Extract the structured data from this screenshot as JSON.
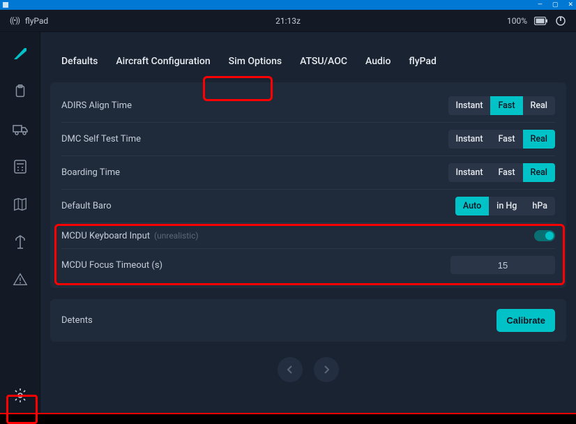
{
  "titlebar": {
    "minimize": "—",
    "maximize": "▢",
    "close": "✕"
  },
  "header": {
    "app_name": "flyPad",
    "time": "21:13z",
    "battery_pct": "100%"
  },
  "tabs": [
    {
      "label": "Defaults"
    },
    {
      "label": "Aircraft Configuration"
    },
    {
      "label": "Sim Options"
    },
    {
      "label": "ATSU/AOC"
    },
    {
      "label": "Audio"
    },
    {
      "label": "flyPad"
    }
  ],
  "rows": {
    "adirs": {
      "label": "ADIRS Align Time",
      "options": [
        "Instant",
        "Fast",
        "Real"
      ],
      "active": 1
    },
    "dmc": {
      "label": "DMC Self Test Time",
      "options": [
        "Instant",
        "Fast",
        "Real"
      ],
      "active": 2
    },
    "board": {
      "label": "Boarding Time",
      "options": [
        "Instant",
        "Fast",
        "Real"
      ],
      "active": 2
    },
    "baro": {
      "label": "Default Baro",
      "options": [
        "Auto",
        "in Hg",
        "hPa"
      ],
      "active": 0
    },
    "mcdu_kb": {
      "label": "MCDU Keyboard Input",
      "hint": "(unrealistic)"
    },
    "mcdu_to": {
      "label": "MCDU Focus Timeout (s)",
      "value": "15"
    }
  },
  "detents": {
    "label": "Detents",
    "button": "Calibrate"
  }
}
